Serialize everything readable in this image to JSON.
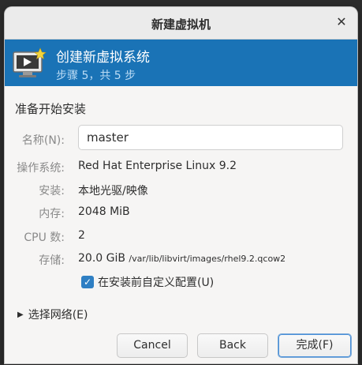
{
  "window": {
    "title": "新建虚拟机"
  },
  "banner": {
    "heading": "创建新虚拟系统",
    "step": "步骤 5，共 5 步"
  },
  "section_title": "准备开始安装",
  "form": {
    "name_label": "名称(N):",
    "name_value": "master",
    "os_label": "操作系统:",
    "os_value": "Red Hat Enterprise Linux 9.2",
    "install_label": "安装:",
    "install_value": "本地光驱/映像",
    "memory_label": "内存:",
    "memory_value": "2048 MiB",
    "cpu_label": "CPU 数:",
    "cpu_value": "2",
    "storage_label": "存储:",
    "storage_size": "20.0 GiB",
    "storage_path": "/var/lib/libvirt/images/rhel9.2.qcow2"
  },
  "customize": {
    "label": "在安装前自定义配置(U)",
    "checked": true
  },
  "network": {
    "label": "选择网络(E)"
  },
  "buttons": {
    "cancel": "Cancel",
    "back": "Back",
    "finish": "完成(F)"
  },
  "colors": {
    "banner": "#1a73b6",
    "accent": "#2f7fc3"
  },
  "icons": {
    "close": "close-icon",
    "logo": "monitor-star-icon",
    "expander": "triangle-right-icon",
    "checkbox": "checkmark-icon"
  }
}
